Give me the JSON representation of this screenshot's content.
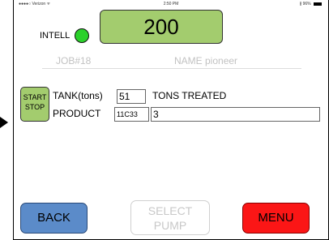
{
  "status_bar": {
    "carrier": "●●●●○ Verizon ᯤ",
    "time": "2:50 PM",
    "battery": "∦ 96%"
  },
  "header": {
    "intell_label": "INTELL",
    "count": "200",
    "dot_color": "#2bd12b"
  },
  "job": {
    "job_label": "JOB#18",
    "name_label": "NAME pioneer"
  },
  "controls": {
    "start_label": "START",
    "stop_label": "STOP",
    "tank_label": "TANK(tons)",
    "tank_value": "51",
    "tons_treated_label": "TONS TREATED",
    "product_label": "PRODUCT",
    "product_code": "11C33",
    "product_value": "3"
  },
  "footer": {
    "back_label": "BACK",
    "select_line1": "SELECT",
    "select_line2": "PUMP",
    "menu_label": "MENU"
  },
  "colors": {
    "green_button": "#a3cc6e",
    "back_blue": "#5b8bc9",
    "menu_red": "#fb1616",
    "disabled_text": "#c8c8c8"
  }
}
